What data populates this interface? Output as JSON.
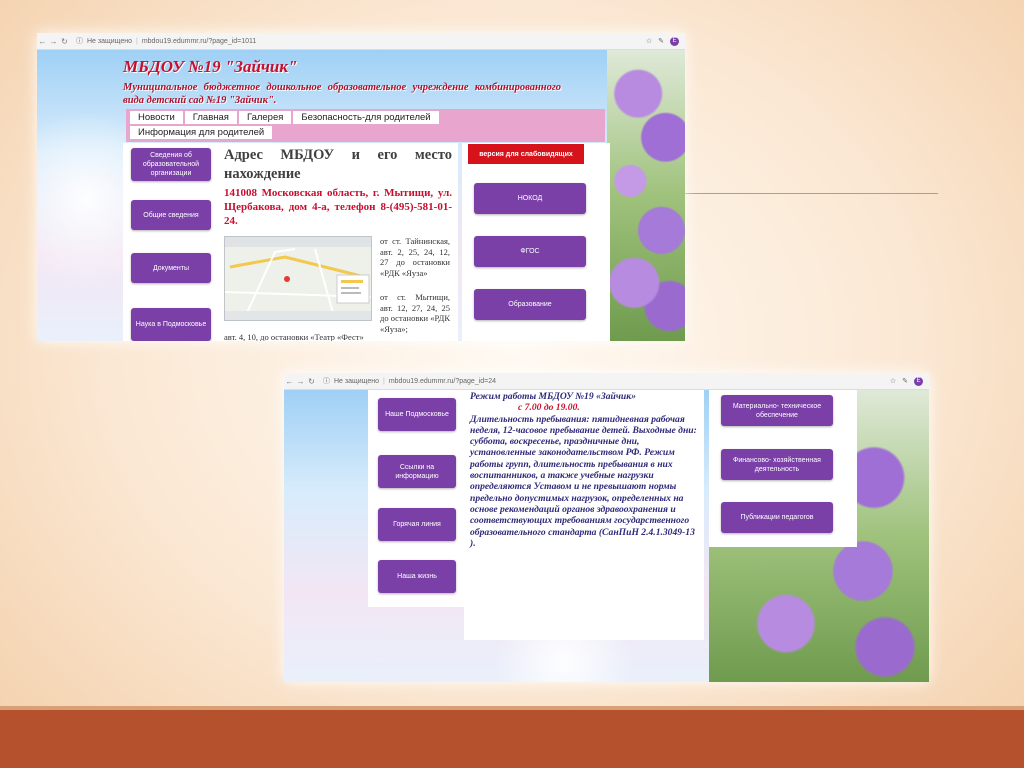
{
  "screenshot1": {
    "browser": {
      "security": "Не защищено",
      "url": "mbdou19.edummr.ru/?page_id=1011",
      "avatar": "Е"
    },
    "site_title": "МБДОУ №19 \"Зайчик\"",
    "site_subtitle": "Муниципальное бюджетное дошкольное образовательное учреждение комбинированного вида детский сад №19 \"Зайчик\".",
    "nav": [
      "Новости",
      "Главная",
      "Галерея",
      "Безопасность-для родителей",
      "Информация для родителей"
    ],
    "left_menu": [
      "Сведения об образовательной организации",
      "Общие сведения",
      "Документы",
      "Наука в Подмосковье"
    ],
    "heading": "Адрес МБДОУ и его место нахождение",
    "address": "141008 Московская область, г. Мытищи, ул. Щербакова, дом 4-а, телефон 8-(495)-581-01-24.",
    "directions_1": "от ст. Тайнинская, авт. 2, 25, 24, 12, 27 до остановки «РДК «Яуза»",
    "directions_2": "от ст. Мытищи, авт. 12, 27, 24, 25 до остановки «РДК «Яуза»;",
    "directions_3": "авт. 4, 10, до остановки «Театр «Фест»",
    "right_menu": {
      "accessible": "версия для слабовидящих",
      "items": [
        "НОКОД",
        "ФГОС",
        "Образование"
      ]
    }
  },
  "screenshot2": {
    "browser": {
      "security": "Не защищено",
      "url": "mbdou19.edummr.ru/?page_id=24",
      "avatar": "Е"
    },
    "left_menu": [
      "Наше Подмосковье",
      "Ссылки на информацию",
      "Горячая линия",
      "Наша жизнь"
    ],
    "schedule_title": "Режим работы МБДОУ №19 «Зайчик»",
    "schedule_hours": "с 7.00 до 19.00.",
    "schedule_body": "Длительность пребывания: пятидневная рабочая неделя, 12-часовое пребывание детей. Выходные дни: суббота, воскресенье, праздничные дни, установленные законодательством РФ. Режим работы групп, длительность пребывания в них воспитанников, а также учебные нагрузки определяются Уставом и не превышают нормы предельно допустимых нагрузок, определенных на основе рекомендаций органов здравоохранения и соответствующих требованиям государственного образовательного стандарта (СанПиН 2.4.1.3049-13 ).",
    "right_menu": [
      "Материально- техническое обеспечение",
      "Финансово- хозяйственная деятельность",
      "Публикации педагогов"
    ]
  },
  "colors": {
    "purple_button": "#7b3fa8",
    "red_text": "#c8102e",
    "accessible_button": "#d6121b",
    "bottom_bar": "#b5522d",
    "nav_bar": "#e8a6cf"
  }
}
